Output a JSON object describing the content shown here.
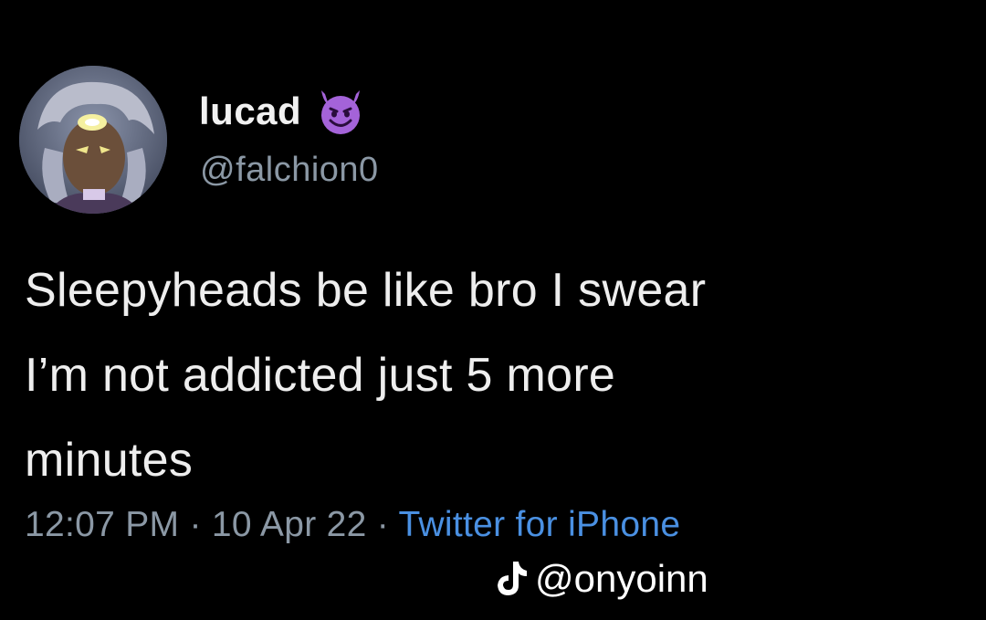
{
  "tweet": {
    "display_name": "lucad",
    "handle": "@falchion0",
    "badge_icon": "smiling-devil-emoji",
    "text_lines": [
      "Sleepyheads be like bro I swear",
      "I’m not addicted just 5 more",
      "minutes"
    ],
    "time": "12:07 PM",
    "date": "10 Apr 22",
    "separator": "·",
    "source": "Twitter for iPhone"
  },
  "watermark": {
    "icon": "tiktok-icon",
    "user": "@onyoinn"
  },
  "colors": {
    "background": "#000000",
    "text": "#eeeeee",
    "secondary": "#8b98a5",
    "link": "#4a90e2",
    "emoji": "#a463d9"
  }
}
